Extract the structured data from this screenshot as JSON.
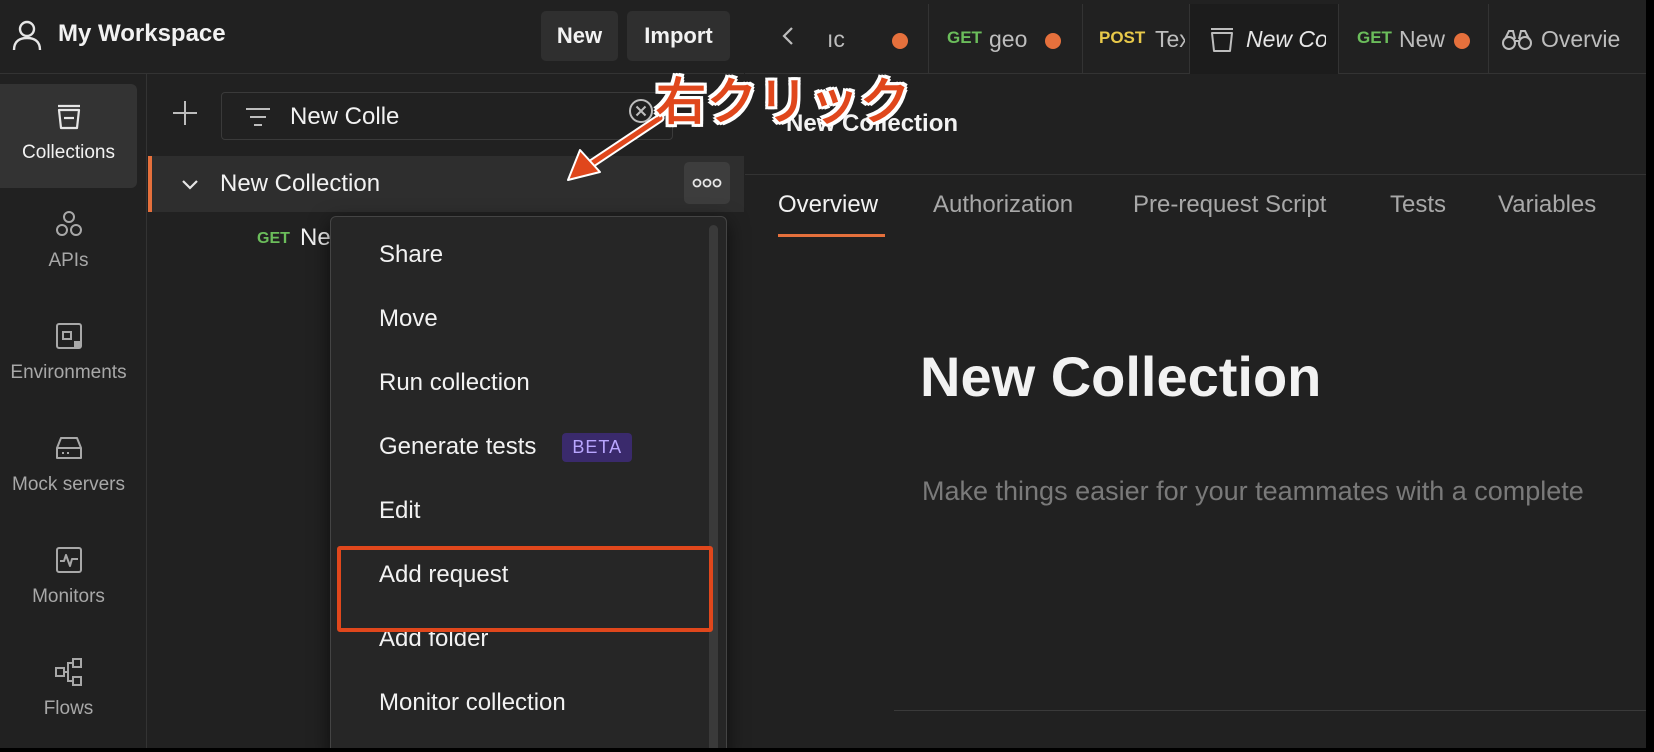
{
  "workspace": {
    "title": "My Workspace",
    "new_label": "New",
    "import_label": "Import"
  },
  "rail": [
    {
      "label": "Collections",
      "icon": "collections-icon",
      "active": true
    },
    {
      "label": "APIs",
      "icon": "apis-icon"
    },
    {
      "label": "Environments",
      "icon": "environments-icon"
    },
    {
      "label": "Mock servers",
      "icon": "mock-servers-icon"
    },
    {
      "label": "Monitors",
      "icon": "monitors-icon"
    },
    {
      "label": "Flows",
      "icon": "flows-icon"
    }
  ],
  "panel": {
    "filter_value": "New Colle",
    "collection_name": "New Collection",
    "request": {
      "method": "GET",
      "name": "Ne"
    }
  },
  "context_menu": {
    "items": [
      "Share",
      "Move",
      "Run collection",
      "Generate tests",
      "Edit",
      "Add request",
      "Add folder",
      "Monitor collection"
    ],
    "beta_label": "BETA",
    "highlighted": "Add request"
  },
  "annotation": {
    "text": "右クリック",
    "color": "#e0471c"
  },
  "tabs": [
    {
      "method": "",
      "name": "ıc",
      "unsaved": true
    },
    {
      "method": "GET",
      "name": "geo",
      "unsaved": true
    },
    {
      "method": "POST",
      "name": "Tex",
      "unsaved": true
    },
    {
      "method": "",
      "name": "New Co",
      "active": true
    },
    {
      "method": "GET",
      "name": "New",
      "unsaved": true
    },
    {
      "method": "",
      "name": "Overvie"
    }
  ],
  "main": {
    "header_title": "New Collection",
    "sub_tabs": [
      "Overview",
      "Authorization",
      "Pre-request Script",
      "Tests",
      "Variables"
    ],
    "active_sub_tab": "Overview",
    "big_title": "New Collection",
    "description_placeholder": "Make things easier for your teammates with a complete"
  },
  "colors": {
    "accent": "#e5703c",
    "get": "#6bbd5b",
    "post": "#e8c94a",
    "background": "#212121"
  }
}
